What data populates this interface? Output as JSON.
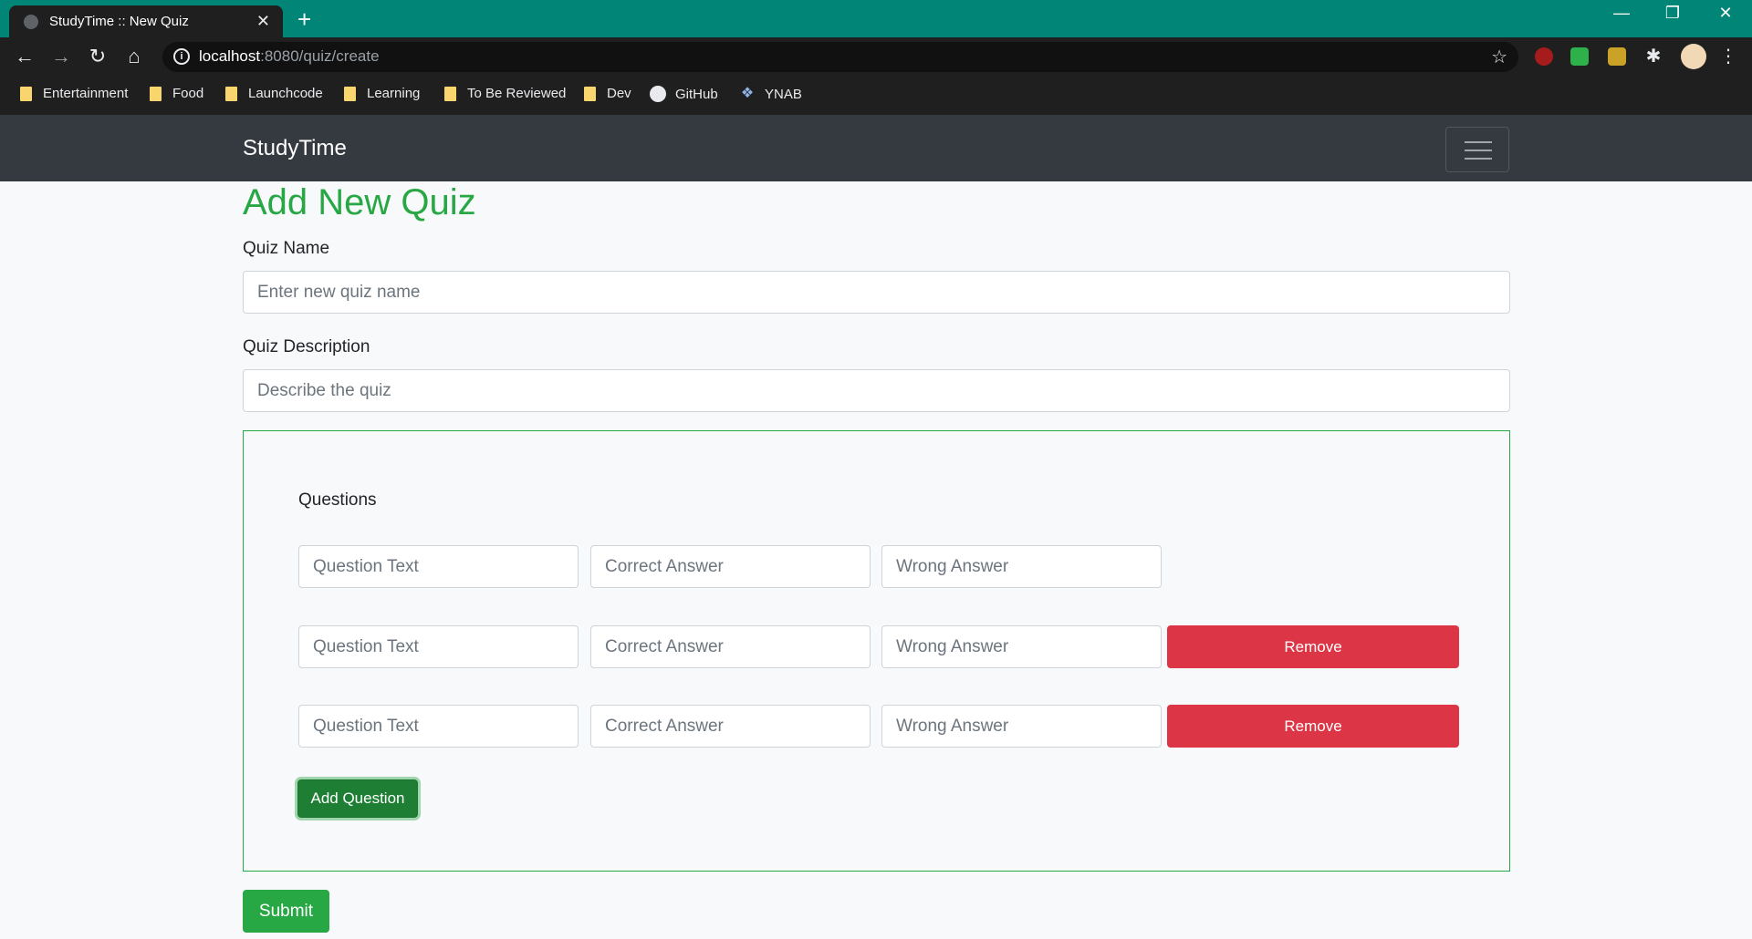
{
  "browser": {
    "tab_title": "StudyTime :: New Quiz",
    "url_host": "localhost",
    "url_rest": ":8080/quiz/create",
    "bookmarks": [
      "Entertainment",
      "Food",
      "Launchcode",
      "Learning",
      "To Be Reviewed",
      "Dev",
      "GitHub",
      "YNAB"
    ]
  },
  "navbar": {
    "brand": "StudyTime"
  },
  "page": {
    "title": "Add New Quiz",
    "quiz_name_label": "Quiz Name",
    "quiz_name_placeholder": "Enter new quiz name",
    "quiz_description_label": "Quiz Description",
    "quiz_description_placeholder": "Describe the quiz",
    "questions_heading": "Questions",
    "question_placeholder": "Question Text",
    "correct_placeholder": "Correct Answer",
    "wrong_placeholder": "Wrong Answer",
    "remove_label": "Remove",
    "add_question_label": "Add Question",
    "submit_label": "Submit"
  },
  "colors": {
    "accent": "#28a745",
    "danger": "#dc3545",
    "navbar": "#343a40",
    "tabbar": "#008577"
  }
}
